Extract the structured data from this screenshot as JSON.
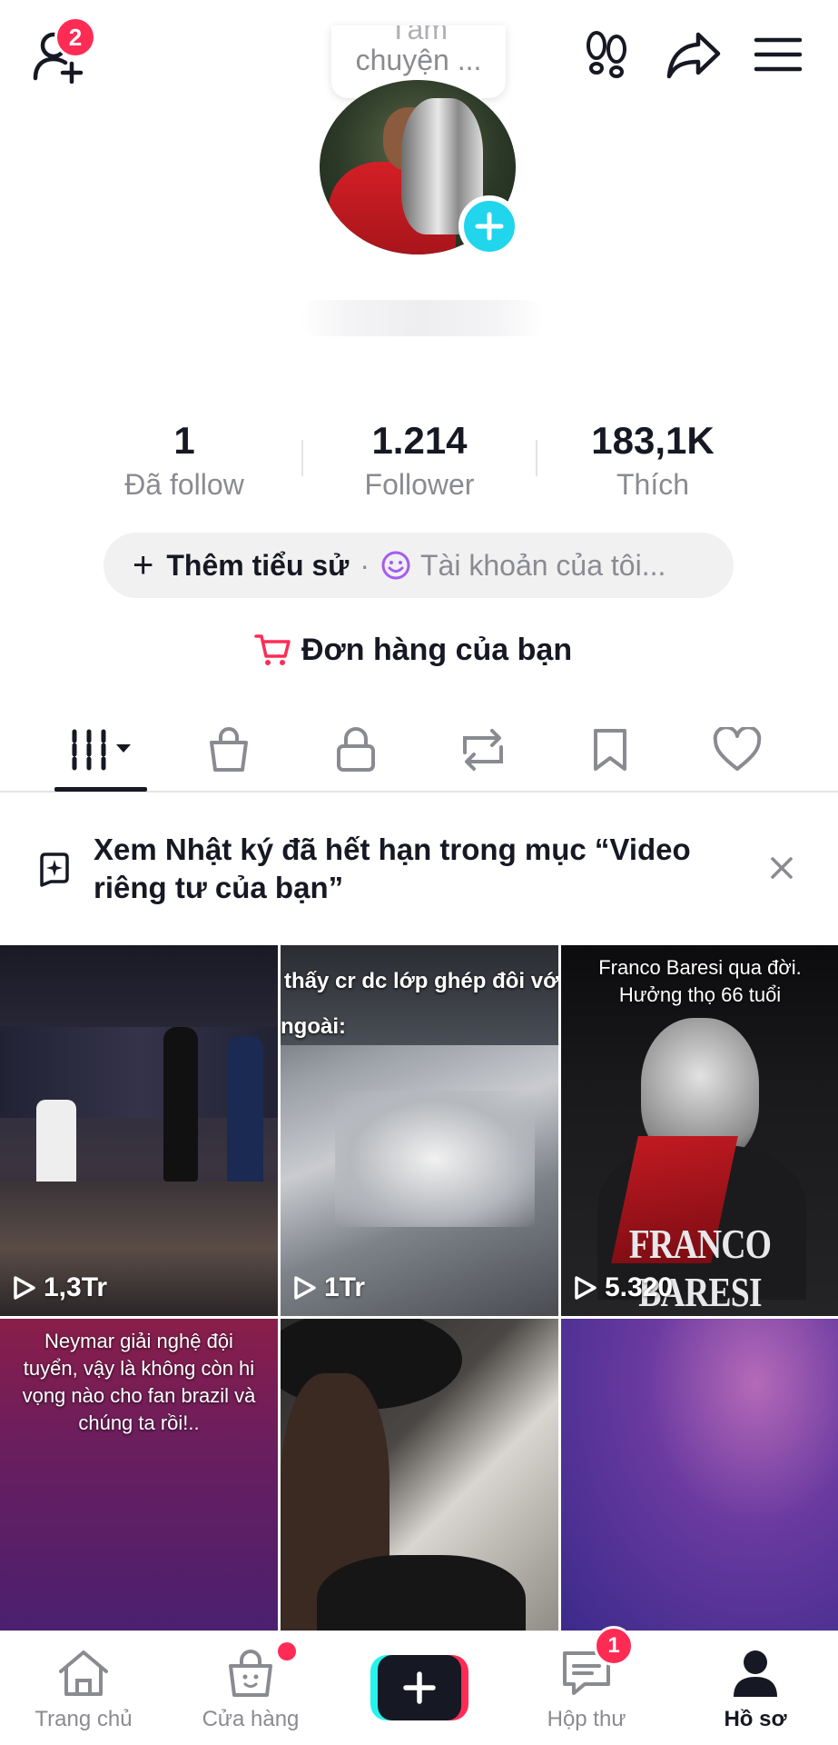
{
  "header": {
    "friend_requests_badge": "2",
    "note_ghost_text": "Tâm",
    "note_text": "chuyện ..."
  },
  "stats": {
    "following": {
      "value": "1",
      "label": "Đã follow"
    },
    "followers": {
      "value": "1.214",
      "label": "Follower"
    },
    "likes": {
      "value": "183,1K",
      "label": "Thích"
    }
  },
  "bio": {
    "add_bio_label": "Thêm tiểu sử",
    "separator": "·",
    "account_label": "Tài khoản của tôi..."
  },
  "orders": {
    "label": "Đơn hàng của bạn"
  },
  "tabs": [
    "videos",
    "shop",
    "private",
    "reposts",
    "favorites",
    "liked"
  ],
  "banner": {
    "text": "Xem Nhật ký đã hết hạn trong mục “Video riêng tư của bạn”"
  },
  "videos": [
    {
      "views": "1,3Tr"
    },
    {
      "views": "1Tr",
      "caption_line1": "thấy cr dc lớp ghép đôi với ngkh",
      "caption_line2": "ngoài:"
    },
    {
      "views": "5.320",
      "caption_line1": "Franco Baresi qua đời.",
      "caption_line2": "Hưởng thọ 66 tuổi",
      "big_title": "FRANCO BARESI"
    },
    {
      "caption": "Neymar giải nghệ đội tuyển, vậy là không còn hi vọng nào cho fan brazil và chúng ta rồi!.."
    },
    {},
    {}
  ],
  "bottom_nav": {
    "home": "Trang chủ",
    "shop": "Cửa hàng",
    "inbox": "Hộp thư",
    "inbox_badge": "1",
    "profile": "Hồ sơ"
  },
  "colors": {
    "accent_red": "#fe2c55",
    "accent_cyan": "#20d5ec",
    "text_primary": "#161823",
    "text_secondary": "#8a8b91"
  }
}
